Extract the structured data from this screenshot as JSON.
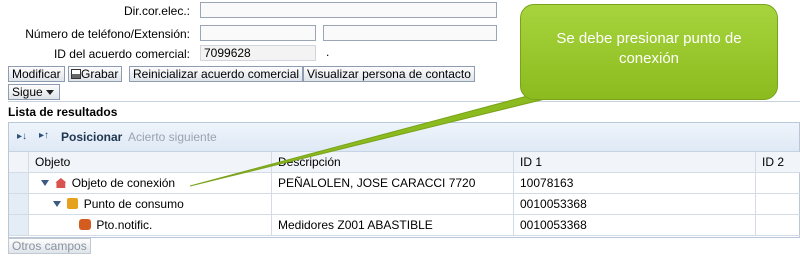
{
  "form": {
    "email_label": "Dir.cor.elec.:",
    "phone_label": "Número de teléfono/Extensión:",
    "agreement_label": "ID del acuerdo comercial:",
    "agreement_value": "7099628",
    "agreement_dot": "."
  },
  "actions": {
    "modify": "Modificar",
    "save": "Grabar",
    "reset": "Reinicializar acuerdo comercial",
    "view_contact": "Visualizar persona de contacto",
    "next": "Sigue"
  },
  "results": {
    "title": "Lista de resultados",
    "toolbar": {
      "position": "Posicionar",
      "next_hit": "Acierto siguiente"
    },
    "columns": [
      "Objeto",
      "Descripción",
      "ID 1",
      "ID 2"
    ],
    "rows": [
      {
        "object": "Objeto de conexión",
        "description": "PEÑALOLEN, JOSE CARACCI 7720",
        "id1": "10078163",
        "id2": ""
      },
      {
        "object": "Punto de consumo",
        "description": "",
        "id1": "0010053368",
        "id2": ""
      },
      {
        "object": "Pto.notific.",
        "description": "Medidores Z001 ABASTIBLE",
        "id1": "0010053368",
        "id2": ""
      }
    ],
    "other_fields": "Otros campos"
  },
  "callout": {
    "text": "Se debe presionar punto de conexión",
    "color": "#96c52b"
  },
  "icons": [
    "expand-all-icon",
    "collapse-all-icon",
    "save-icon",
    "dropdown-arrow-icon",
    "triangle-down-icon",
    "house-icon",
    "meter-icon",
    "notification-icon"
  ]
}
